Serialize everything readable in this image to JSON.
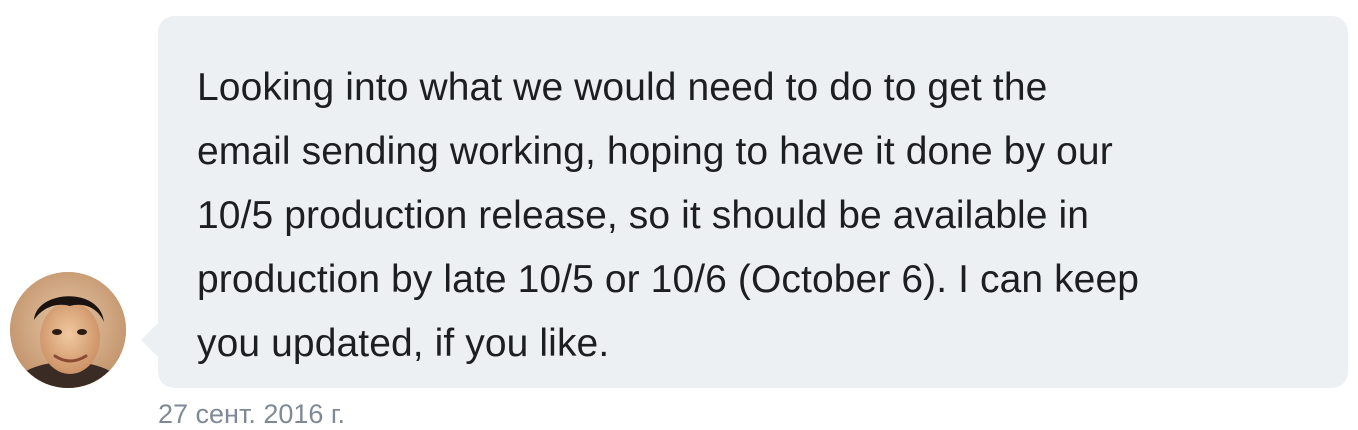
{
  "message": {
    "text": "Looking into what we would need to do to get the\nemail sending working, hoping to have it done by our\n10/5 production release, so it should be available in\nproduction by late 10/5 or 10/6 (October 6). I can keep\nyou updated, if you like.",
    "timestamp": "27 сент. 2016 г.",
    "bubble_color": "#edf0f3",
    "text_color": "#1c1e21",
    "timestamp_color": "#7f8a96"
  },
  "sender": {
    "avatar_icon": "user-avatar-photo"
  }
}
